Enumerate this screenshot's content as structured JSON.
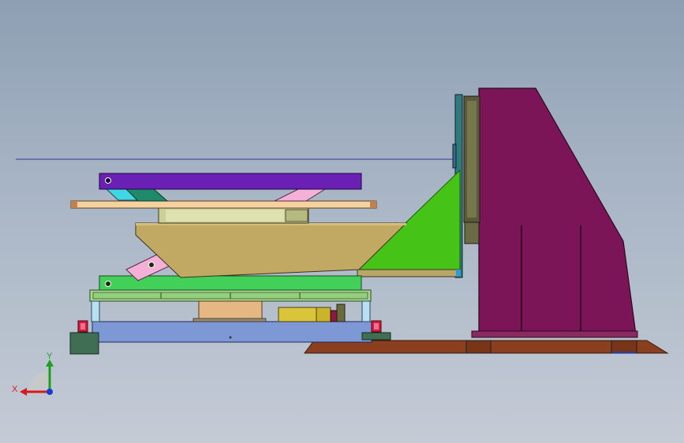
{
  "viewport": {
    "background_top": "#8e9fb3",
    "background_bottom": "#c4cbd5"
  },
  "model": {
    "colors": {
      "purple_arm": "#6a1fb5",
      "magenta_column": "#7b1558",
      "green_bracket": "#45c417",
      "tan_table": "#c1a963",
      "light_plate": "#f3d2a0",
      "base_plate": "#7e98d6",
      "floor_plate": "#8a3f1f",
      "green_frame": "#43d05a",
      "rail": "#93cf7d",
      "motor": "#d9c43a",
      "turntable": "#cbcf9a",
      "pink_link": "#f3b1d8",
      "cyan_link": "#3fd6e6",
      "foot": "#3f6e55",
      "red_block": "#d81a3c"
    }
  },
  "triad": {
    "x_label": "X",
    "y_label": "Y",
    "x_icon": "x-axis-arrow-icon",
    "y_icon": "y-axis-arrow-icon",
    "z_icon": "z-axis-dot-icon"
  }
}
